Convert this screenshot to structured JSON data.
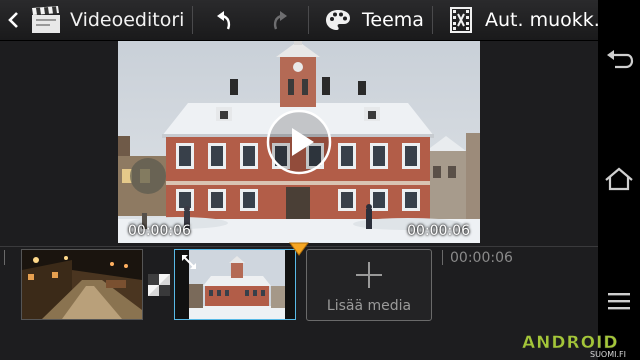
{
  "app": {
    "title": "Videoeditori",
    "icon": "clapperboard-icon"
  },
  "toolbar": {
    "undo_icon": "undo-icon",
    "redo_icon": "redo-icon",
    "redo_enabled": false,
    "theme_label": "Teema",
    "theme_icon": "palette-icon",
    "auto_edit_label": "Aut. muokk.",
    "auto_edit_icon": "film-edit-icon"
  },
  "preview": {
    "start_time": "00:00:06",
    "end_time": "00:00:06",
    "play_icon": "play-icon"
  },
  "timeline": {
    "ticks": [
      "00:00:06"
    ],
    "clips": [
      {
        "name": "night-street-clip",
        "selected": false
      },
      {
        "name": "town-hall-clip",
        "selected": true
      }
    ],
    "transition_icon": "transition-icon",
    "add_media_label": "Lisää media",
    "add_media_icon": "plus-icon"
  },
  "navigation": {
    "icons": [
      "back-icon",
      "home-icon",
      "menu-icon"
    ]
  },
  "watermark": {
    "text": "ANDROID",
    "subtext": "SUOMI.FI"
  },
  "colors": {
    "selection": "#58b9e6",
    "playhead": "#f5a623",
    "watermark": "#a4c639"
  }
}
